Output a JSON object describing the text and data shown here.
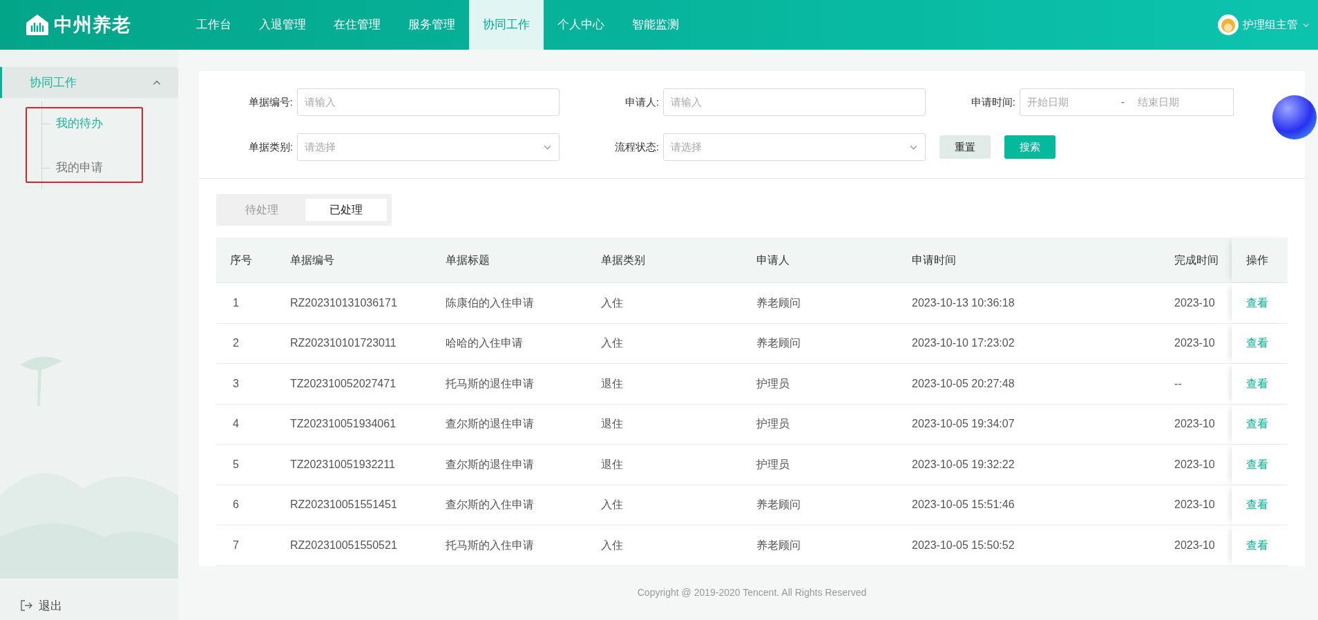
{
  "header": {
    "logo": "中州养老",
    "nav": [
      {
        "label": "工作台",
        "selected": false
      },
      {
        "label": "入退管理",
        "selected": false
      },
      {
        "label": "在住管理",
        "selected": false
      },
      {
        "label": "服务管理",
        "selected": false
      },
      {
        "label": "协同工作",
        "selected": true
      },
      {
        "label": "个人中心",
        "selected": false
      },
      {
        "label": "智能监测",
        "selected": false
      }
    ],
    "user": "护理组主管"
  },
  "sidebar": {
    "group": {
      "label": "协同工作",
      "expanded": true
    },
    "items": [
      {
        "label": "我的待办",
        "selected": true
      },
      {
        "label": "我的申请",
        "selected": false
      }
    ],
    "logout": "退出"
  },
  "filters": {
    "number": {
      "label": "单据编号:",
      "placeholder": "请输入"
    },
    "applicant": {
      "label": "申请人:",
      "placeholder": "请输入"
    },
    "time": {
      "label": "申请时间:",
      "start_placeholder": "开始日期",
      "separator": "-",
      "end_placeholder": "结束日期"
    },
    "category": {
      "label": "单据类别:",
      "placeholder": "请选择"
    },
    "status": {
      "label": "流程状态:",
      "placeholder": "请选择"
    },
    "reset": "重置",
    "search": "搜索"
  },
  "tabs": [
    {
      "label": "待处理",
      "selected": false
    },
    {
      "label": "已处理",
      "selected": true
    }
  ],
  "table": {
    "columns": [
      "序号",
      "单据编号",
      "单据标题",
      "单据类别",
      "申请人",
      "申请时间",
      "完成时间",
      "操作"
    ],
    "rows": [
      [
        "1",
        "RZ202310131036171",
        "陈康伯的入住申请",
        "入住",
        "养老顾问",
        "2023-10-13 10:36:18",
        "2023-10",
        "查看"
      ],
      [
        "2",
        "RZ202310101723011",
        "哈哈的入住申请",
        "入住",
        "养老顾问",
        "2023-10-10 17:23:02",
        "2023-10",
        "查看"
      ],
      [
        "3",
        "TZ202310052027471",
        "托马斯的退住申请",
        "退住",
        "护理员",
        "2023-10-05 20:27:48",
        "--",
        "查看"
      ],
      [
        "4",
        "TZ202310051934061",
        "查尔斯的退住申请",
        "退住",
        "护理员",
        "2023-10-05 19:34:07",
        "2023-10",
        "查看"
      ],
      [
        "5",
        "TZ202310051932211",
        "查尔斯的退住申请",
        "退住",
        "护理员",
        "2023-10-05 19:32:22",
        "2023-10",
        "查看"
      ],
      [
        "6",
        "RZ202310051551451",
        "查尔斯的入住申请",
        "入住",
        "养老顾问",
        "2023-10-05 15:51:46",
        "2023-10",
        "查看"
      ],
      [
        "7",
        "RZ202310051550521",
        "托马斯的入住申请",
        "入住",
        "养老顾问",
        "2023-10-05 15:50:52",
        "2023-10",
        "查看"
      ]
    ]
  },
  "footer": "Copyright @ 2019-2020 Tencent. All Rights Reserved"
}
